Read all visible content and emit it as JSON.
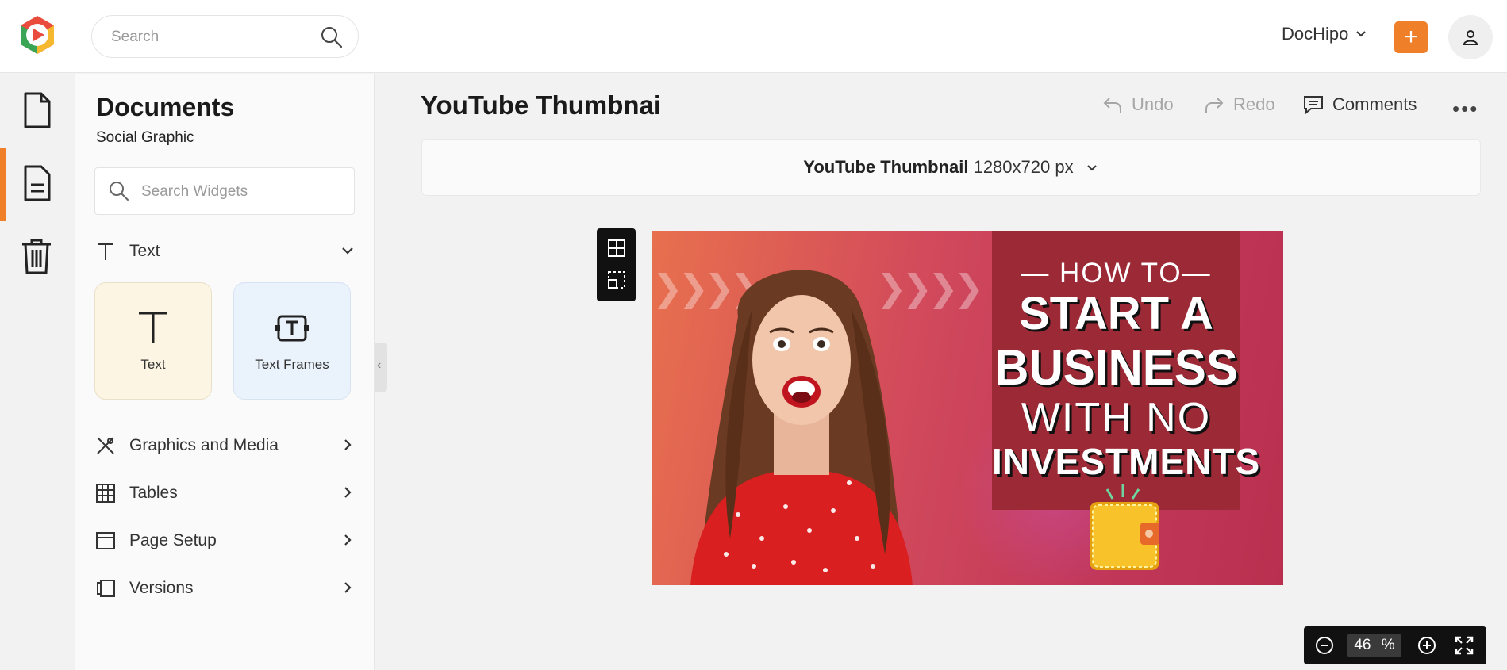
{
  "header": {
    "search_placeholder": "Search",
    "brand_label": "DocHipo",
    "add_label": "+"
  },
  "rail": {
    "items": [
      "document-icon",
      "file-text-icon",
      "trash-icon"
    ]
  },
  "panel": {
    "title": "Documents",
    "subtitle": "Social Graphic",
    "widget_search_placeholder": "Search Widgets",
    "text_section": "Text",
    "tiles": [
      {
        "label": "Text",
        "bg": "#fdf5e3"
      },
      {
        "label": "Text Frames",
        "bg": "#eaf2fb"
      }
    ],
    "sections": [
      "Graphics and Media",
      "Tables",
      "Page Setup",
      "Versions"
    ]
  },
  "document": {
    "title": "YouTube Thumbnai",
    "undo": "Undo",
    "redo": "Redo",
    "comments": "Comments",
    "size_name": "YouTube Thumbnail",
    "size_dims": "1280x720 px"
  },
  "thumbnail": {
    "line1": "— HOW TO—",
    "line2": "START A",
    "line3": "BUSINESS",
    "line4": "WITH NO",
    "line5": "INVESTMENTS",
    "chevrons": "❯❯❯❯"
  },
  "zoom": {
    "value": "46",
    "unit": "%"
  },
  "colors": {
    "accent": "#f07f2a",
    "headline_box": "#9c2a36"
  }
}
